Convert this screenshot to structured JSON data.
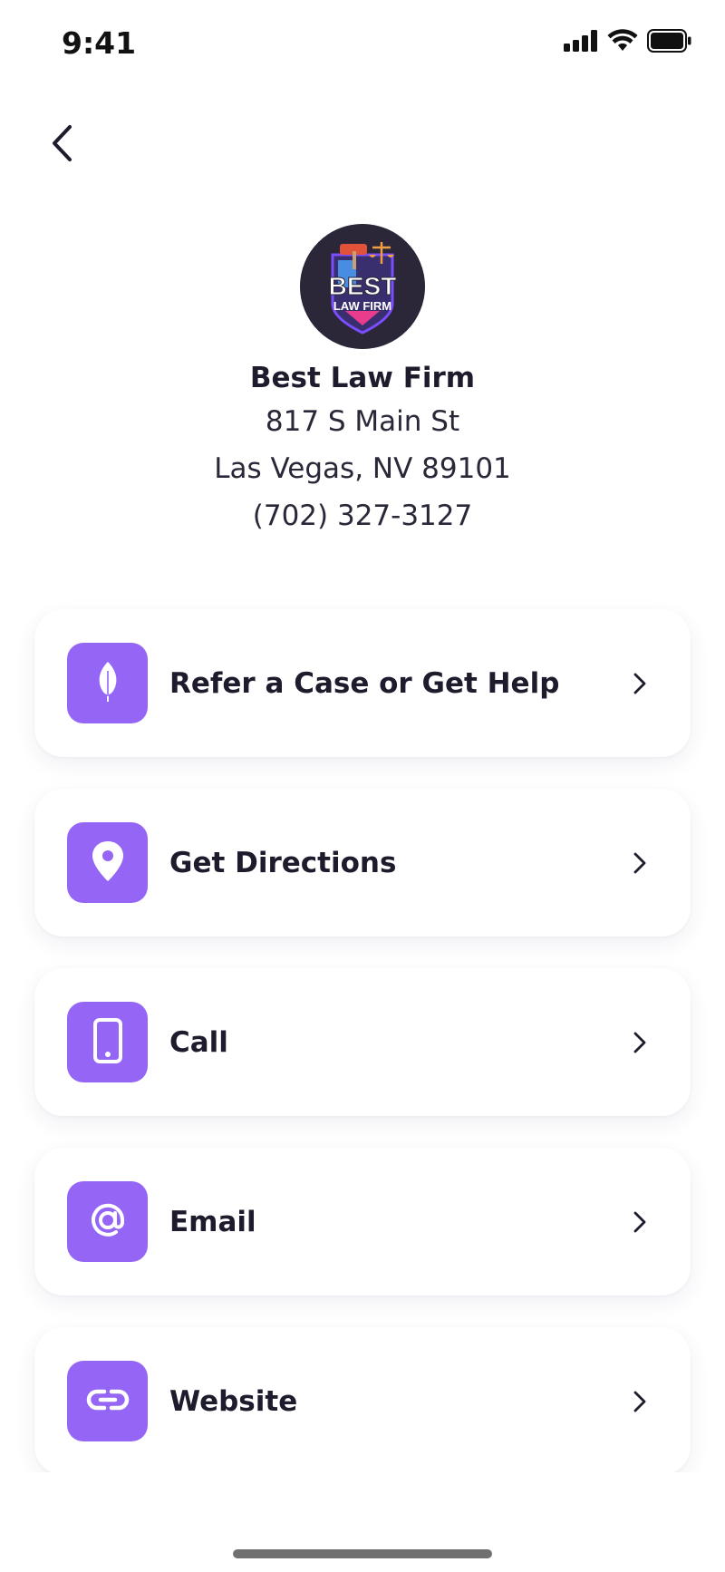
{
  "status_bar": {
    "time": "9:41",
    "icons": [
      "signal-icon",
      "wifi-icon",
      "battery-icon"
    ]
  },
  "nav": {
    "back_icon": "chevron-left-icon"
  },
  "firm": {
    "logo_text_line1": "BEST",
    "logo_text_line2": "LAW FIRM",
    "name": "Best Law Firm",
    "street": "817 S Main St",
    "city_state_zip": "Las Vegas, NV 89101",
    "phone": "(702) 327-3127"
  },
  "menu": {
    "items": [
      {
        "label": "Refer a Case or Get Help",
        "icon": "feather-icon"
      },
      {
        "label": "Get Directions",
        "icon": "map-pin-icon"
      },
      {
        "label": "Call",
        "icon": "phone-icon"
      },
      {
        "label": "Email",
        "icon": "at-sign-icon"
      },
      {
        "label": "Website",
        "icon": "link-icon"
      }
    ]
  },
  "colors": {
    "accent": "#9566f6",
    "text": "#1d1b2c",
    "background": "#ffffff"
  }
}
